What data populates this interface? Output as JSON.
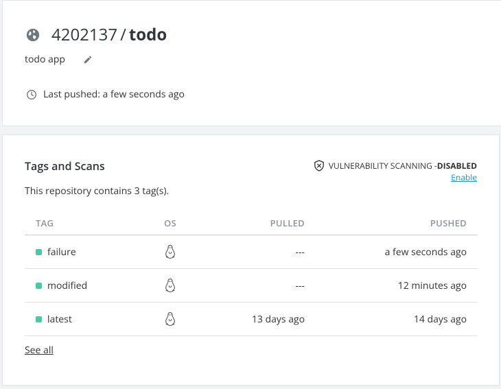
{
  "repo": {
    "namespace": "4202137",
    "separator": "/",
    "name": "todo",
    "description": "todo app",
    "last_pushed": "Last pushed: a few seconds ago"
  },
  "tags_section": {
    "title": "Tags and Scans",
    "vulnerability_label": "VULNERABILITY SCANNING - ",
    "vulnerability_status": "DISABLED",
    "enable_link": "Enable",
    "contains_text": "This repository contains 3 tag(s).",
    "headers": {
      "tag": "TAG",
      "os": "OS",
      "pulled": "PULLED",
      "pushed": "PUSHED"
    },
    "rows": [
      {
        "tag": "failure",
        "os_icon": "linux-icon",
        "pulled": "---",
        "pushed": "a few seconds ago",
        "status_color": "#4cc9a4"
      },
      {
        "tag": "modified",
        "os_icon": "linux-icon",
        "pulled": "---",
        "pushed": "12 minutes ago",
        "status_color": "#4cc9a4"
      },
      {
        "tag": "latest",
        "os_icon": "linux-icon",
        "pulled": "13 days ago",
        "pushed": "14 days ago",
        "status_color": "#4cc9a4"
      }
    ],
    "see_all": "See all"
  },
  "icons": {
    "globe": "globe-icon",
    "edit": "pencil-icon",
    "clock": "clock-icon",
    "shield": "shield-x-icon"
  },
  "colors": {
    "accent_link": "#1e90d8",
    "tag_status": "#4cc9a4"
  }
}
